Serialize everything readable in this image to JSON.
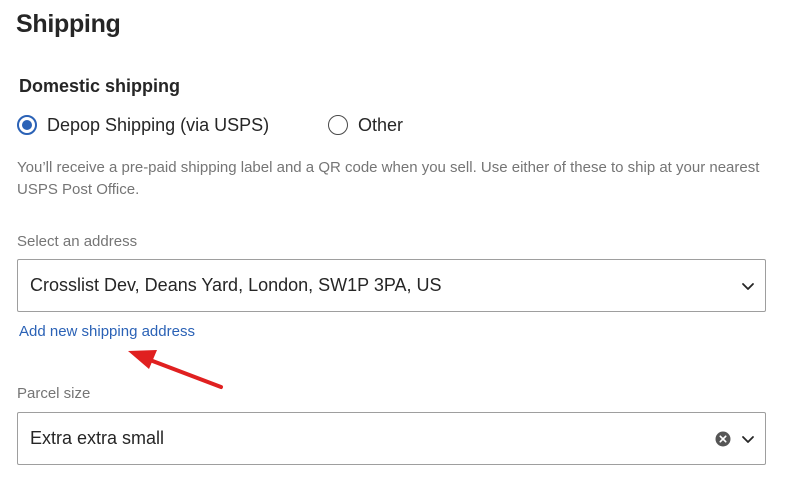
{
  "page": {
    "title": "Shipping"
  },
  "domestic": {
    "heading": "Domestic shipping",
    "options": [
      {
        "label": "Depop Shipping (via USPS)",
        "selected": true
      },
      {
        "label": "Other",
        "selected": false
      }
    ],
    "description": "You’ll receive a pre-paid shipping label and a QR code when you sell. Use either of these to ship at your nearest USPS Post Office."
  },
  "address": {
    "label": "Select an address",
    "value": "Crosslist Dev, Deans Yard, London, SW1P 3PA, US",
    "add_link": "Add new shipping address"
  },
  "parcel": {
    "label": "Parcel size",
    "value": "Extra extra small"
  },
  "colors": {
    "accent": "#2b62b6",
    "annotation_arrow": "#e02020"
  },
  "icons": {
    "dropdown": "chevron-down-icon",
    "clear": "clear-x-icon",
    "annotation": "red-arrow-icon"
  }
}
